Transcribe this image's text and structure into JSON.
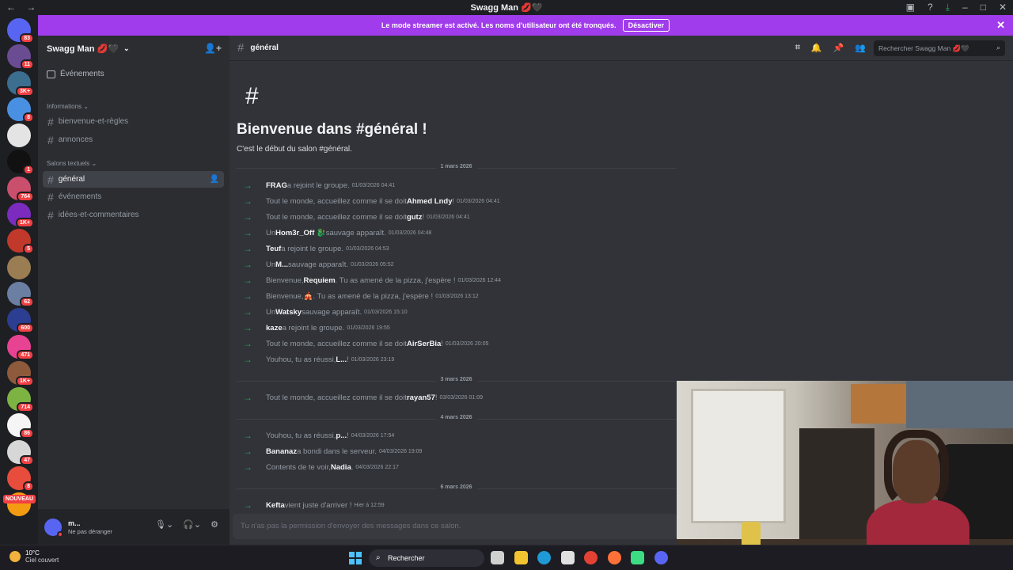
{
  "titlebar": {
    "title": "Swagg Man 💋🖤",
    "back": "←",
    "forward": "→"
  },
  "banner": {
    "text": "Le mode streamer est activé. Les noms d'utilisateur ont été tronqués.",
    "button": "Désactiver"
  },
  "servers": [
    {
      "badge": "83",
      "color": "#5865f2"
    },
    {
      "badge": "11",
      "color": "#6a4c93"
    },
    {
      "badge": "3K+",
      "color": "#3b6e8f"
    },
    {
      "badge": "8",
      "color": "#4a90e2"
    },
    {
      "badge": "",
      "color": "#e4e4e4"
    },
    {
      "badge": "1",
      "color": "#111111"
    },
    {
      "badge": "764",
      "color": "#c94f6d"
    },
    {
      "badge": "1K+",
      "color": "#7b2cbf"
    },
    {
      "badge": "5",
      "color": "#c0392b"
    },
    {
      "badge": "",
      "color": "#9a7d52"
    },
    {
      "badge": "62",
      "color": "#6b7fa3"
    },
    {
      "badge": "600",
      "color": "#2c3e91"
    },
    {
      "badge": "471",
      "color": "#e84393"
    },
    {
      "badge": "1K+",
      "color": "#8e5a3c"
    },
    {
      "badge": "714",
      "color": "#7cb342"
    },
    {
      "badge": "86",
      "color": "#f5f5f5"
    },
    {
      "badge": "47",
      "color": "#d7d7d7"
    },
    {
      "badge": "8",
      "color": "#e74c3c"
    },
    {
      "badge": "",
      "color": "#f39c12"
    }
  ],
  "new_label": "NOUVEAU",
  "server": {
    "name": "Swagg Man 💋🖤",
    "events": "Événements",
    "categories": [
      {
        "name": "Informations ⌄",
        "channels": [
          "bienvenue-et-règles",
          "annonces"
        ]
      },
      {
        "name": "Salons textuels ⌄",
        "channels": [
          "général",
          "événements",
          "idées-et-commentaires"
        ]
      }
    ]
  },
  "user": {
    "name": "m...",
    "status": "Ne pas déranger"
  },
  "channel": {
    "name": "général",
    "search_placeholder": "Rechercher Swagg Man 💋🖤",
    "welcome_title": "Bienvenue dans #général !",
    "welcome_sub": "C'est le début du salon #général.",
    "composer": "Tu n'as pas la permission d'envoyer des messages dans ce salon."
  },
  "dates": [
    "1 mars 2026",
    "3 mars 2026",
    "4 mars 2026",
    "6 mars 2026"
  ],
  "messages": [
    {
      "pre": "",
      "who": "FRAG",
      "post": " a rejoint le groupe.",
      "ts": "01/03/2026 04:41"
    },
    {
      "pre": "Tout le monde, accueillez comme il se doit ",
      "who": "Ahmed Lndy",
      "post": " !",
      "ts": "01/03/2026 04:41"
    },
    {
      "pre": "Tout le monde, accueillez comme il se doit ",
      "who": "gutz",
      "post": " !",
      "ts": "01/03/2026 04:41"
    },
    {
      "pre": "Un ",
      "who": "Hom3r_Off 🐉",
      "post": " sauvage apparaît.",
      "ts": "01/03/2026 04:48"
    },
    {
      "pre": "",
      "who": "Teuf",
      "post": " a rejoint le groupe.",
      "ts": "01/03/2026 04:53"
    },
    {
      "pre": "Un ",
      "who": "M...",
      "post": " sauvage apparaît.",
      "ts": "01/03/2026 05:52"
    },
    {
      "pre": "Bienvenue, ",
      "who": "Requiem",
      "post": ". Tu as amené de la pizza, j'espère !",
      "ts": "01/03/2026 12:44"
    },
    {
      "pre": "Bienvenue, ",
      "who": "🎪",
      "post": ". Tu as amené de la pizza, j'espère !",
      "ts": "01/03/2026 13:12"
    },
    {
      "pre": "Un ",
      "who": "Watsky",
      "post": " sauvage apparaît.",
      "ts": "01/03/2026 15:10"
    },
    {
      "pre": "",
      "who": "kaze",
      "post": " a rejoint le groupe.",
      "ts": "01/03/2026 19:55"
    },
    {
      "pre": "Tout le monde, accueillez comme il se doit ",
      "who": "AirSerBia",
      "post": " !",
      "ts": "01/03/2026 20:05"
    },
    {
      "pre": "Youhou, tu as réussi, ",
      "who": "L...",
      "post": " !",
      "ts": "01/03/2026 23:19"
    },
    {
      "pre": "Tout le monde, accueillez comme il se doit ",
      "who": "rayan57",
      "post": " !",
      "ts": "03/03/2026 01:09"
    },
    {
      "pre": "Youhou, tu as réussi, ",
      "who": "p...",
      "post": " !",
      "ts": "04/03/2026 17:54"
    },
    {
      "pre": "",
      "who": "Bananaz",
      "post": " a bondi dans le serveur.",
      "ts": "04/03/2026 19:09"
    },
    {
      "pre": "Contents de te voir, ",
      "who": "Nadia",
      "post": ".",
      "ts": "04/03/2026 22:17"
    },
    {
      "pre": "",
      "who": "Kefta",
      "post": " vient juste d'arriver !",
      "ts": "Hier à 12:59"
    }
  ],
  "taskbar": {
    "temp": "10°C",
    "condition": "Ciel couvert",
    "search": "Rechercher",
    "apps": [
      {
        "name": "task-view",
        "color": "#d0d0d0"
      },
      {
        "name": "file-explorer",
        "color": "#f4c430"
      },
      {
        "name": "edge",
        "color": "#1f9ad6"
      },
      {
        "name": "store",
        "color": "#e0e0e0"
      },
      {
        "name": "chrome",
        "color": "#e34133"
      },
      {
        "name": "firefox",
        "color": "#ff7139"
      },
      {
        "name": "android-studio",
        "color": "#3ddc84"
      },
      {
        "name": "discord",
        "color": "#5865f2"
      }
    ]
  }
}
